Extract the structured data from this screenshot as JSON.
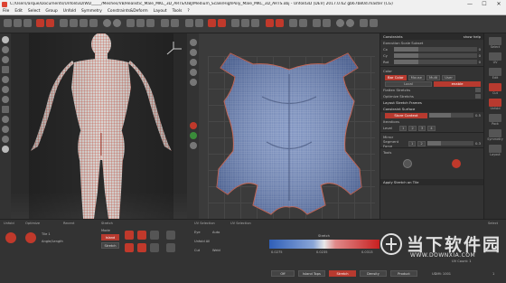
{
  "window": {
    "title": "C:/Users/arque/Documents/Unfold3D/WD_____/Meshes/VB/Realistic_Male_MKC_3D_ARTS/OBJ/Medium_Scale/HighPoly_Male_MKC_3D_ARTS.obj - Unfold3D [DEV] 2017.0.62 gb67b80d.master (CG)",
    "minimize": "—",
    "maximize": "☐",
    "close": "✕"
  },
  "menu": {
    "items": [
      "File",
      "Edit",
      "Select",
      "Group",
      "Unfold",
      "Symmetry",
      "Constraints&Deform",
      "Layout",
      "Tools",
      "?"
    ]
  },
  "right_panel": {
    "header_left": "Constraints",
    "header_right": "show help",
    "section1": "Execution Scale Subset",
    "rows": [
      {
        "label": "Cx",
        "value": "0"
      },
      {
        "label": "Cy",
        "value": "0"
      },
      {
        "label": "Rot",
        "value": "0"
      }
    ],
    "color_label": "Color",
    "color_tabs": [
      "Bar Color",
      "Mouse",
      "Multi",
      "User"
    ],
    "local_label": "Local",
    "enable_label": "enable",
    "flat_label": "Flatten Stretchs",
    "optimize_label": "Optimize Stretchs",
    "section2": "Layout Stretch Frames",
    "section3": "Constraint Surface",
    "unfold_btn": "Store Context",
    "field1": {
      "label": "Iterations",
      "value": "0.5"
    },
    "level_label": "Level",
    "mirror_label": "Mirror",
    "segment_label": "Segment Force",
    "segment_value": "0.3",
    "tools_label": "Tools",
    "footer": "Apply Stretch on Tile"
  },
  "far_right": {
    "labels": [
      "Select",
      "UV",
      "Edit",
      "Cut",
      "Unfold",
      "Pack",
      "Symmetry",
      "Layout"
    ]
  },
  "bottom": {
    "sections": [
      "Unfold",
      "Optimize",
      "Recent",
      "Stretch",
      "UV Selection",
      "UV Selection",
      "Select"
    ],
    "labels": {
      "tile_left": "Tile 1",
      "angle": "Angle/Length",
      "island": "Island",
      "mode": "Mode",
      "stretch": "Stretch",
      "eye": "Eye",
      "auto": "Auto",
      "unfold_all": "Unfold All",
      "cut": "Cut",
      "weld": "Weld",
      "stretch_label": "Stretch",
      "min_val": "0.0275",
      "mid_val": "0.0235",
      "max_val": "0.0313",
      "off": "Off",
      "island_tops": "Island Tops",
      "stretch_btn": "Stretch",
      "density": "Density",
      "product": "Product",
      "uv_count": "UV Count: 1",
      "coord": "UDIM: 1001",
      "version": "1"
    }
  },
  "watermark": {
    "text": "当下软件园",
    "url": "WWW.DOWNXIA.COM"
  },
  "colors": {
    "accent": "#b83a2f",
    "panel": "#333333",
    "mesh_warm": "#c85a4a",
    "mesh_cool": "#5a7ab8"
  }
}
